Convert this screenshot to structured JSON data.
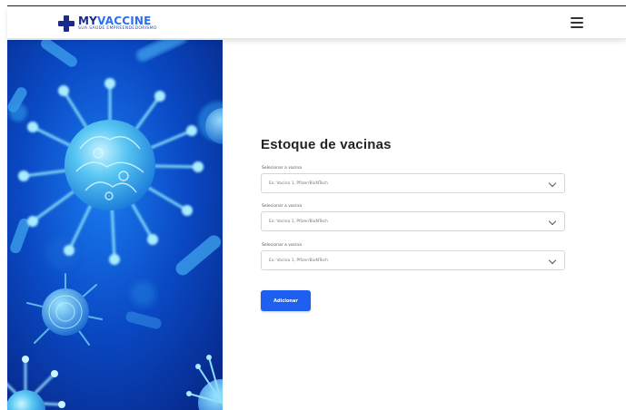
{
  "brand": {
    "name_part1": "MY",
    "name_part2": "VACCINE",
    "tagline": "SUA SAÚDE EMPREENDEDORISMO",
    "brand_color": "#1b2a8a",
    "accent_color": "#2b6ff0"
  },
  "header": {
    "menu_icon": "hamburger-menu-icon"
  },
  "hero": {
    "image": "coronavirus-illustration"
  },
  "form": {
    "title": "Estoque de vacinas",
    "fields": [
      {
        "label": "Selecionar a vacina",
        "value": "Ex: Vacina 1, Pfizer/BioNTech"
      },
      {
        "label": "Selecionar a vacina",
        "value": "Ex: Vacina 1, Pfizer/BioNTech"
      },
      {
        "label": "Selecionar a vacina",
        "value": "Ex: Vacina 1, Pfizer/BioNTech"
      }
    ],
    "submit_label": "Adicionar",
    "submit_color": "#1f5ff0"
  }
}
